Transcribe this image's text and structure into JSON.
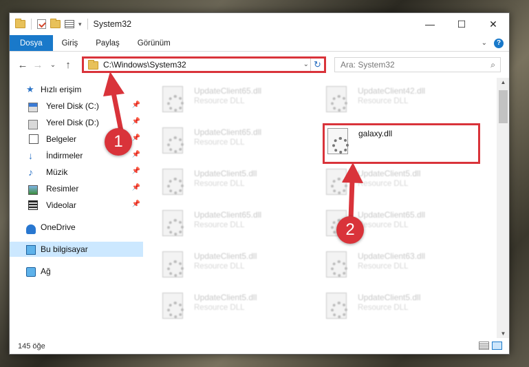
{
  "window": {
    "title": "System32",
    "controls": {
      "minimize": "—",
      "maximize": "☐",
      "close": "✕"
    }
  },
  "ribbon": {
    "tabs": [
      "Dosya",
      "Giriş",
      "Paylaş",
      "Görünüm"
    ],
    "help": "?"
  },
  "nav": {
    "back": "←",
    "forward": "→",
    "recent": "⌄",
    "up": "↑",
    "address": "C:\\Windows\\System32",
    "search_placeholder": "Ara: System32"
  },
  "sidebar": {
    "quick_access": "Hızlı erişim",
    "items": [
      {
        "label": "Yerel Disk (C:)",
        "icon": "drive-c-icon",
        "pinned": true
      },
      {
        "label": "Yerel Disk (D:)",
        "icon": "drive-icon",
        "pinned": true
      },
      {
        "label": "Belgeler",
        "icon": "documents-icon",
        "pinned": true
      },
      {
        "label": "İndirmeler",
        "icon": "downloads-icon",
        "pinned": true
      },
      {
        "label": "Müzik",
        "icon": "music-icon",
        "pinned": true
      },
      {
        "label": "Resimler",
        "icon": "pictures-icon",
        "pinned": true
      },
      {
        "label": "Videolar",
        "icon": "videos-icon",
        "pinned": true
      }
    ],
    "onedrive": "OneDrive",
    "this_pc": "Bu bilgisayar",
    "network": "Ağ"
  },
  "files": {
    "left_column": [
      {
        "name": "UpdateClient65.dll",
        "type": "Resource DLL"
      },
      {
        "name": "UpdateClient65.dll",
        "type": "Resource DLL"
      },
      {
        "name": "UpdateClient5.dll",
        "type": "Resource DLL"
      },
      {
        "name": "UpdateClient65.dll",
        "type": "Resource DLL"
      },
      {
        "name": "UpdateClient5.dll",
        "type": "Resource DLL"
      },
      {
        "name": "UpdateClient5.dll",
        "type": "Resource DLL"
      }
    ],
    "right_column": [
      {
        "name": "UpdateClient42.dll",
        "type": "Resource DLL"
      },
      {
        "name": "galaxy.dll",
        "type": ""
      },
      {
        "name": "UpdateClient5.dll",
        "type": "Resource DLL"
      },
      {
        "name": "UpdateClient65.dll",
        "type": "Resource DLL"
      },
      {
        "name": "UpdateClient63.dll",
        "type": "Resource DLL"
      },
      {
        "name": "UpdateClient5.dll",
        "type": "Resource DLL"
      }
    ],
    "highlighted": "galaxy.dll"
  },
  "status": {
    "item_count": "145 öğe"
  },
  "annotations": {
    "step1": "1",
    "step2": "2",
    "color": "#d9333a"
  }
}
